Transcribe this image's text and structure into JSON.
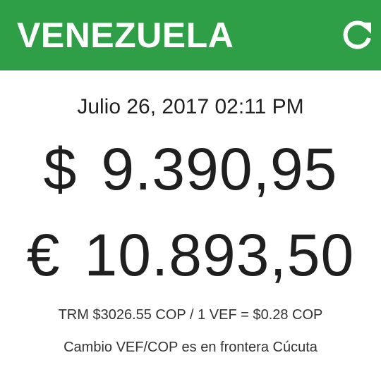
{
  "header": {
    "title": "VENEZUELA",
    "background_color": "#2e9e47",
    "refresh_icon": "refresh-icon"
  },
  "rates": {
    "timestamp": "Julio 26, 2017 02:11 PM",
    "usd_symbol": "$",
    "usd_value": "9.390,95",
    "eur_symbol": "€",
    "eur_value": "10.893,50"
  },
  "footer": {
    "trm_text": "TRM $3026.55 COP / 1 VEF = $0.28 COP",
    "note_text": "Cambio VEF/COP es en frontera Cúcuta"
  }
}
